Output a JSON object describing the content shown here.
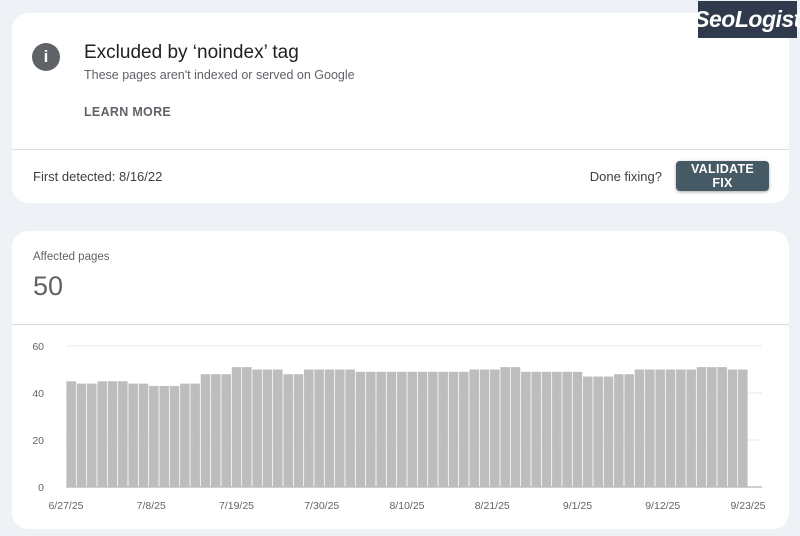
{
  "issue": {
    "icon": "info-icon",
    "title": "Excluded by ‘noindex’ tag",
    "description": "These pages aren't indexed or served on Google",
    "learn_more": "LEARN MORE",
    "first_detected": "First detected: 8/16/22",
    "done_fixing": "Done fixing?",
    "validate_button": "VALIDATE FIX",
    "button_color": "#455a64"
  },
  "metric": {
    "label": "Affected pages",
    "value": "50"
  },
  "watermark": {
    "text": "SeoLogist"
  },
  "chart_data": {
    "type": "bar",
    "ylim": [
      0,
      60
    ],
    "yticks": [
      0,
      20,
      40,
      60
    ],
    "bar_color": "#bdbdbd",
    "grid": true,
    "start_date": "6/27/25",
    "x_tick_labels": [
      "6/27/25",
      "7/8/25",
      "7/19/25",
      "7/30/25",
      "8/10/25",
      "8/21/25",
      "9/1/25",
      "9/12/25",
      "9/23/25"
    ],
    "x_tick_indices": [
      0,
      11,
      22,
      33,
      44,
      55,
      66,
      77,
      88
    ],
    "values": [
      45,
      44,
      44,
      45,
      45,
      45,
      44,
      44,
      43,
      43,
      43,
      44,
      44,
      48,
      48,
      48,
      51,
      51,
      50,
      50,
      50,
      48,
      48,
      50,
      50,
      50,
      50,
      50,
      49,
      49,
      49,
      49,
      49,
      49,
      49,
      49,
      49,
      49,
      49,
      50,
      50,
      50,
      51,
      51,
      49,
      49,
      49,
      49,
      49,
      49,
      47,
      47,
      47,
      48,
      48,
      50,
      50,
      50,
      50,
      50,
      50,
      51,
      51,
      51,
      50,
      50
    ]
  }
}
